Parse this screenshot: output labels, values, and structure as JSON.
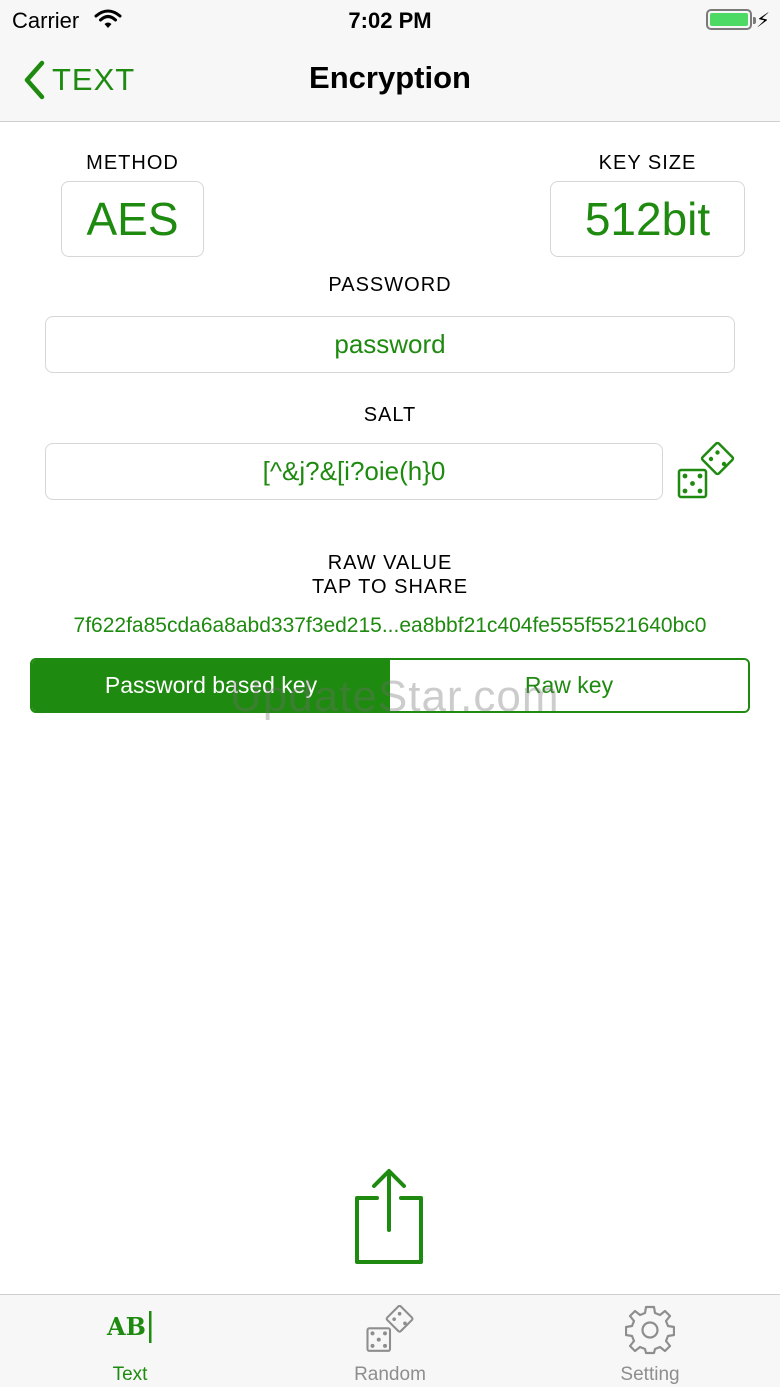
{
  "status_bar": {
    "carrier": "Carrier",
    "time": "7:02 PM"
  },
  "nav": {
    "back_label": "TEXT",
    "title": "Encryption"
  },
  "method": {
    "label": "METHOD",
    "value": "AES"
  },
  "key_size": {
    "label": "KEY SIZE",
    "value": "512bit"
  },
  "password": {
    "label": "PASSWORD",
    "value": "password"
  },
  "salt": {
    "label": "SALT",
    "value": "[^&j?&[i?oie(h}0"
  },
  "raw": {
    "label_line1": "RAW VALUE",
    "label_line2": "TAP TO SHARE",
    "value": "7f622fa85cda6a8abd337f3ed215...ea8bbf21c404fe555f5521640bc0"
  },
  "key_mode": {
    "options": [
      "Password based key",
      "Raw key"
    ],
    "selected": "Password based key"
  },
  "watermark": "UpdateStar.com",
  "tabs": [
    {
      "label": "Text",
      "icon": "text-ab-icon",
      "active": true
    },
    {
      "label": "Random",
      "icon": "dice-icon",
      "active": false
    },
    {
      "label": "Setting",
      "icon": "gear-icon",
      "active": false
    }
  ],
  "colors": {
    "accent": "#1f8a10",
    "inactive": "#8e8e8e",
    "bar_bg": "#f7f7f7"
  }
}
